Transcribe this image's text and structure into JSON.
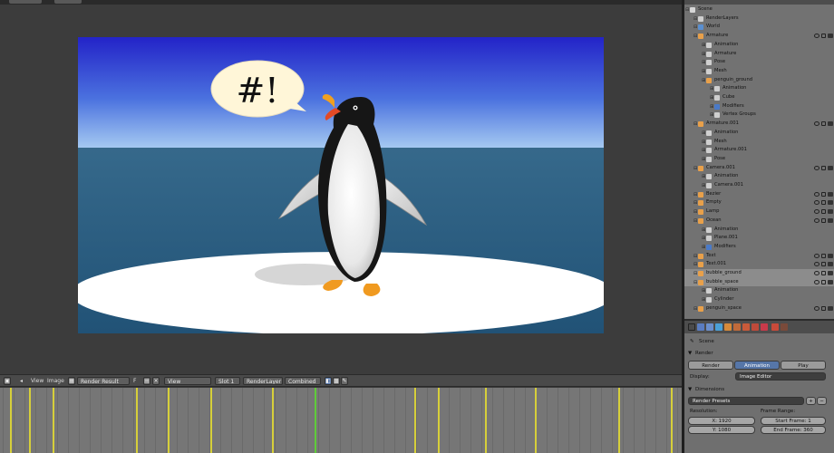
{
  "speech_bubble": {
    "text": "#!"
  },
  "image_header": {
    "view_menu": "View",
    "image_menu": "Image",
    "image_name": "Render Result",
    "f_label": "F",
    "view_select": "View",
    "slot_select": "Slot 1",
    "layer_select": "RenderLayer",
    "pass_select": "Combined"
  },
  "outliner": {
    "rows": [
      {
        "label": "Scene",
        "indent": 0,
        "icon_color": "#d6d6d6"
      },
      {
        "label": "RenderLayers",
        "indent": 1,
        "icon_color": "#cfcfcf"
      },
      {
        "label": "World",
        "indent": 1,
        "icon_color": "#5a8fd0"
      },
      {
        "label": "Armature",
        "indent": 1,
        "icon_color": "#e8a04a"
      },
      {
        "label": "Animation",
        "indent": 2,
        "icon_color": "#cfcfcf"
      },
      {
        "label": "Armature",
        "indent": 2,
        "icon_color": "#cfcfcf"
      },
      {
        "label": "Pose",
        "indent": 2,
        "icon_color": "#cfcfcf"
      },
      {
        "label": "Mesh",
        "indent": 2,
        "icon_color": "#cfcfcf"
      },
      {
        "label": "penguin_ground",
        "indent": 2,
        "icon_color": "#e8a04a"
      },
      {
        "label": "Animation",
        "indent": 3,
        "icon_color": "#cfcfcf"
      },
      {
        "label": "Cube",
        "indent": 3,
        "icon_color": "#cfcfcf"
      },
      {
        "label": "Modifiers",
        "indent": 3,
        "icon_color": "#4a7ac8"
      },
      {
        "label": "Vertex Groups",
        "indent": 3,
        "icon_color": "#cfcfcf"
      },
      {
        "label": "Armature.001",
        "indent": 1,
        "icon_color": "#e8a04a"
      },
      {
        "label": "Animation",
        "indent": 2,
        "icon_color": "#cfcfcf"
      },
      {
        "label": "Mesh",
        "indent": 2,
        "icon_color": "#cfcfcf"
      },
      {
        "label": "Armature.001",
        "indent": 2,
        "icon_color": "#cfcfcf"
      },
      {
        "label": "Pose",
        "indent": 2,
        "icon_color": "#cfcfcf"
      },
      {
        "label": "Camera.001",
        "indent": 1,
        "icon_color": "#e8a04a"
      },
      {
        "label": "Animation",
        "indent": 2,
        "icon_color": "#cfcfcf"
      },
      {
        "label": "Camera.001",
        "indent": 2,
        "icon_color": "#cfcfcf"
      },
      {
        "label": "Bezier",
        "indent": 1,
        "icon_color": "#e8a04a"
      },
      {
        "label": "Empty",
        "indent": 1,
        "icon_color": "#e8a04a"
      },
      {
        "label": "Lamp",
        "indent": 1,
        "icon_color": "#e8a04a"
      },
      {
        "label": "Ocean",
        "indent": 1,
        "icon_color": "#e8a04a"
      },
      {
        "label": "Animation",
        "indent": 2,
        "icon_color": "#cfcfcf"
      },
      {
        "label": "Plane.001",
        "indent": 2,
        "icon_color": "#cfcfcf"
      },
      {
        "label": "Modifiers",
        "indent": 2,
        "icon_color": "#4a7ac8"
      },
      {
        "label": "Text",
        "indent": 1,
        "icon_color": "#e8a04a"
      },
      {
        "label": "Text.001",
        "indent": 1,
        "icon_color": "#e8a04a"
      },
      {
        "label": "bubble_ground",
        "indent": 1,
        "icon_color": "#e8a04a"
      },
      {
        "label": "bubble_space",
        "indent": 1,
        "icon_color": "#e8a04a"
      },
      {
        "label": "Animation",
        "indent": 2,
        "icon_color": "#cfcfcf"
      },
      {
        "label": "Cylinder",
        "indent": 2,
        "icon_color": "#cfcfcf"
      },
      {
        "label": "penguin_space",
        "indent": 1,
        "icon_color": "#e8a04a"
      }
    ]
  },
  "properties": {
    "context": "Scene",
    "render_panel": "Render",
    "render_btn": "Render",
    "animation_btn": "Animation",
    "play_btn": "Play",
    "display_label": "Display:",
    "display_value": "Image Editor",
    "dimensions_panel": "Dimensions",
    "presets": "Render Presets",
    "resolution_label": "Resolution:",
    "frame_range_label": "Frame Range:",
    "res_x": "X: 1920",
    "res_y": "Y: 1080",
    "start_frame": "Start Frame: 1",
    "end_frame": "End Frame: 360"
  },
  "colors": {
    "sky_top": "#2323c8",
    "sky_horizon": "#9ec3ee",
    "sea": "#2f6a8f",
    "ice": "#ffffff",
    "timeline_marker": "#d6cf3a",
    "timeline_cursor": "#5fcc3a",
    "button_active": "#5676a8"
  }
}
